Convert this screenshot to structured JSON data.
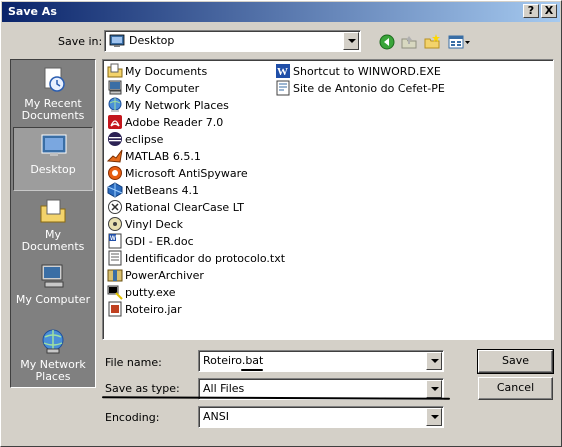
{
  "window": {
    "title": "Save As",
    "help_label": "?",
    "close_label": "X"
  },
  "toolbar": {
    "save_in_label": "Save in:",
    "save_in_value": "Desktop",
    "back_icon": "back-arrow-icon",
    "up_icon": "up-folder-icon",
    "new_folder_icon": "new-folder-icon",
    "views_icon": "views-menu-icon"
  },
  "places": [
    {
      "label_line1": "My Recent",
      "label_line2": "Documents",
      "icon": "recent-documents-icon",
      "selected": false
    },
    {
      "label_line1": "Desktop",
      "label_line2": "",
      "icon": "desktop-icon",
      "selected": true
    },
    {
      "label_line1": "My Documents",
      "label_line2": "",
      "icon": "my-documents-icon",
      "selected": false
    },
    {
      "label_line1": "My Computer",
      "label_line2": "",
      "icon": "my-computer-icon",
      "selected": false
    },
    {
      "label_line1": "My Network",
      "label_line2": "Places",
      "icon": "network-places-icon",
      "selected": false
    }
  ],
  "files_col1": [
    {
      "name": "My Documents",
      "icon": "folder-icon"
    },
    {
      "name": "My Computer",
      "icon": "computer-icon"
    },
    {
      "name": "My Network Places",
      "icon": "network-icon"
    },
    {
      "name": "Adobe Reader 7.0",
      "icon": "adobe-reader-icon"
    },
    {
      "name": "eclipse",
      "icon": "eclipse-icon"
    },
    {
      "name": "MATLAB 6.5.1",
      "icon": "matlab-icon"
    },
    {
      "name": "Microsoft AntiSpyware",
      "icon": "antispyware-icon"
    },
    {
      "name": "NetBeans 4.1",
      "icon": "netbeans-icon"
    },
    {
      "name": "Rational ClearCase LT",
      "icon": "clearcase-icon"
    },
    {
      "name": "Vinyl Deck",
      "icon": "vinyl-deck-icon"
    },
    {
      "name": "GDI - ER.doc",
      "icon": "word-doc-icon"
    },
    {
      "name": "Identificador do protocolo.txt",
      "icon": "text-file-icon"
    },
    {
      "name": "PowerArchiver",
      "icon": "powerarchiver-icon"
    },
    {
      "name": "putty.exe",
      "icon": "putty-icon"
    },
    {
      "name": "Roteiro.jar",
      "icon": "jar-file-icon"
    }
  ],
  "files_col2": [
    {
      "name": "Shortcut to WINWORD.EXE",
      "icon": "word-shortcut-icon"
    },
    {
      "name": "Site de Antonio do Cefet-PE",
      "icon": "web-shortcut-icon"
    }
  ],
  "form": {
    "file_name_label": "File name:",
    "file_name_value": "Roteiro.bat",
    "save_type_label": "Save as type:",
    "save_type_value": "All Files",
    "encoding_label": "Encoding:",
    "encoding_value": "ANSI",
    "save_button": "Save",
    "cancel_button": "Cancel"
  },
  "colors": {
    "titlebar_start": "#0a246a",
    "titlebar_end": "#a6caf0",
    "dialog_face": "#d4d0c8",
    "places_bar": "#808080"
  }
}
